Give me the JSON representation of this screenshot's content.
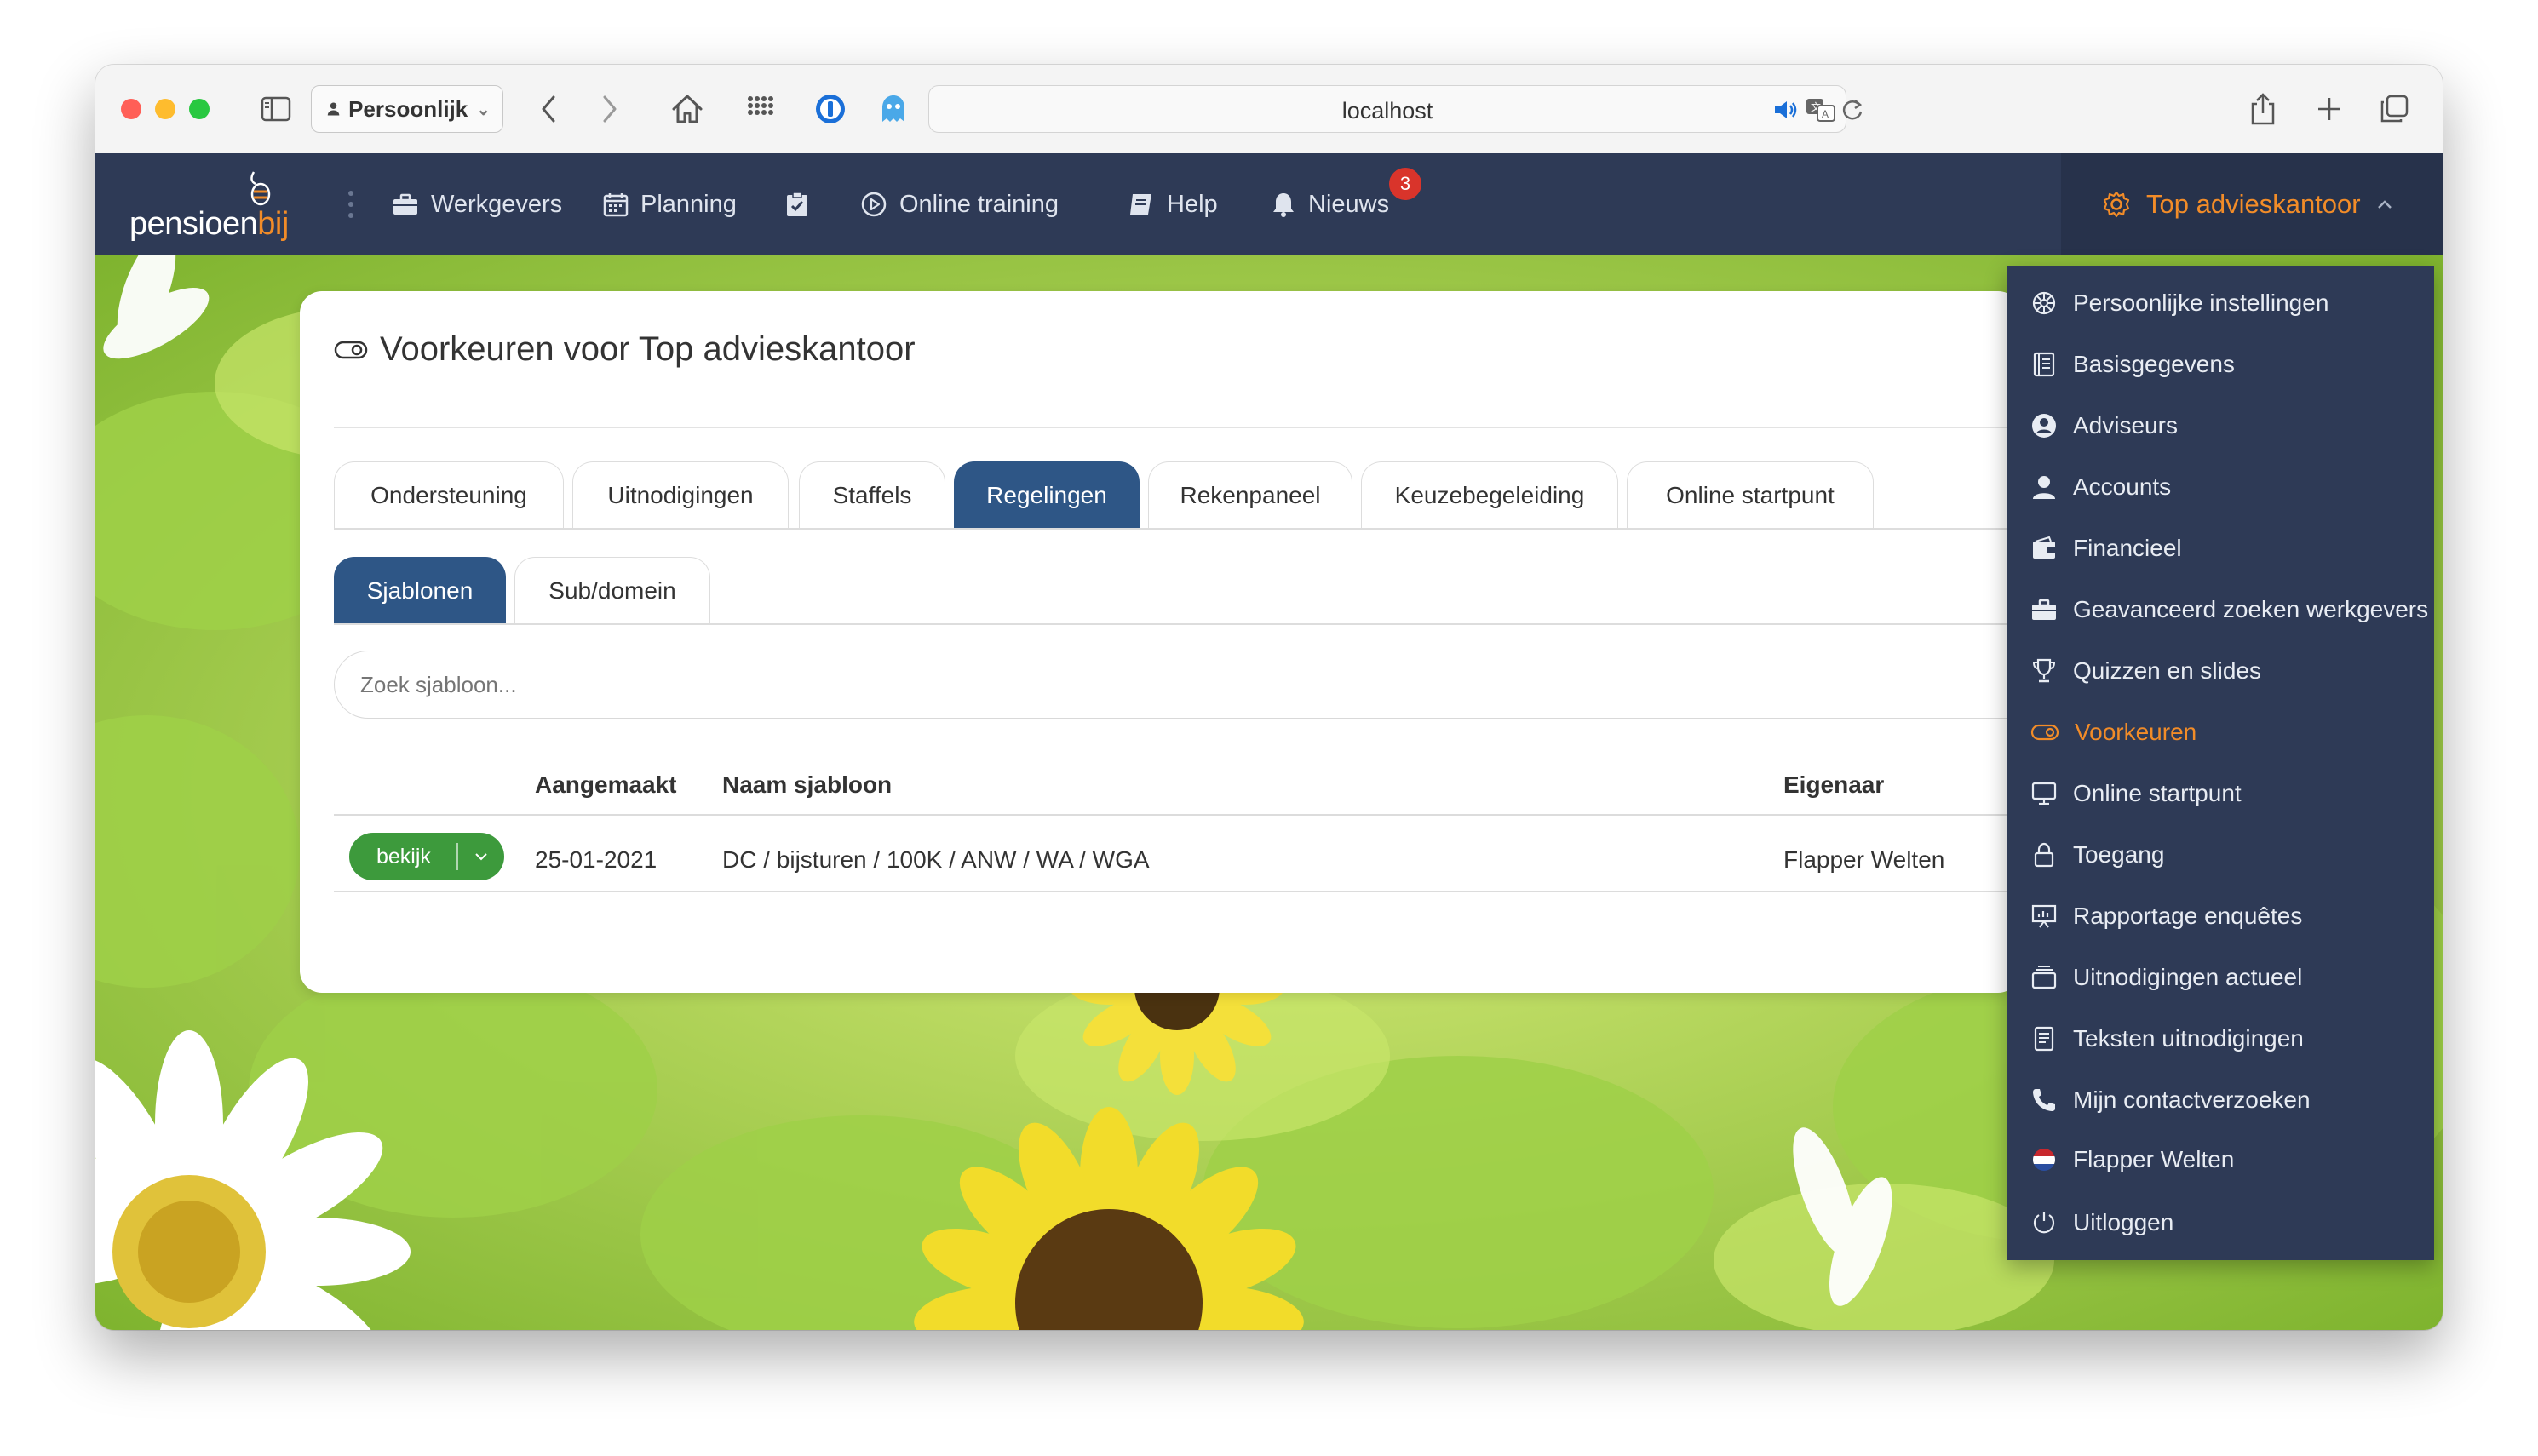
{
  "browser": {
    "profile_label": "Persoonlijk",
    "url": "localhost"
  },
  "nav": {
    "logo_main": "pensioen",
    "logo_accent": "bij",
    "items": [
      {
        "label": "Werkgevers",
        "icon": "briefcase-icon"
      },
      {
        "label": "Planning",
        "icon": "calendar-icon"
      },
      {
        "label": "",
        "icon": "clipboard-check-icon"
      },
      {
        "label": "Online training",
        "icon": "play-circle-icon"
      },
      {
        "label": "Help",
        "icon": "book-icon"
      },
      {
        "label": "Nieuws",
        "icon": "bell-icon",
        "badge": "3"
      }
    ],
    "account_label": "Top advieskantoor"
  },
  "page": {
    "title": "Voorkeuren voor Top advieskantoor",
    "tabs": [
      "Ondersteuning",
      "Uitnodigingen",
      "Staffels",
      "Regelingen",
      "Rekenpaneel",
      "Keuzebegeleiding",
      "Online startpunt"
    ],
    "active_tab": "Regelingen",
    "subtabs": [
      "Sjablonen",
      "Sub/domein"
    ],
    "active_subtab": "Sjablonen",
    "search_placeholder": "Zoek sjabloon...",
    "table": {
      "columns": [
        "Aangemaakt",
        "Naam sjabloon",
        "Eigenaar"
      ],
      "rows": [
        {
          "action": "bekijk",
          "created": "25-01-2021",
          "name": "DC / bijsturen / 100K / ANW / WA / WGA",
          "owner": "Flapper Welten"
        }
      ]
    }
  },
  "account_menu": {
    "items": [
      {
        "label": "Persoonlijke instellingen",
        "icon": "cog-wheel-icon"
      },
      {
        "label": "Basisgegevens",
        "icon": "document-list-icon"
      },
      {
        "label": "Adviseurs",
        "icon": "user-circle-icon"
      },
      {
        "label": "Accounts",
        "icon": "user-icon"
      },
      {
        "label": "Financieel",
        "icon": "wallet-icon"
      },
      {
        "label": "Geavanceerd zoeken werkgevers",
        "icon": "briefcase-icon"
      },
      {
        "label": "Quizzen en slides",
        "icon": "trophy-icon"
      },
      {
        "label": "Voorkeuren",
        "icon": "toggle-icon",
        "active": true
      },
      {
        "label": "Online startpunt",
        "icon": "monitor-icon"
      },
      {
        "label": "Toegang",
        "icon": "lock-icon"
      },
      {
        "label": "Rapportage enquêtes",
        "icon": "presentation-icon"
      },
      {
        "label": "Uitnodigingen actueel",
        "icon": "inbox-stack-icon"
      },
      {
        "label": "Teksten uitnodigingen",
        "icon": "text-document-icon"
      },
      {
        "label": "Mijn contactverzoeken",
        "icon": "phone-icon"
      },
      {
        "label": "Flapper Welten",
        "icon": "dutch-flag-icon"
      },
      {
        "label": "Uitloggen",
        "icon": "power-icon"
      }
    ]
  },
  "colors": {
    "navbar": "#2e3a56",
    "accent": "#f28c28",
    "active_tab": "#2e5686",
    "action_button": "#3d9a3c",
    "badge": "#d9342b"
  }
}
